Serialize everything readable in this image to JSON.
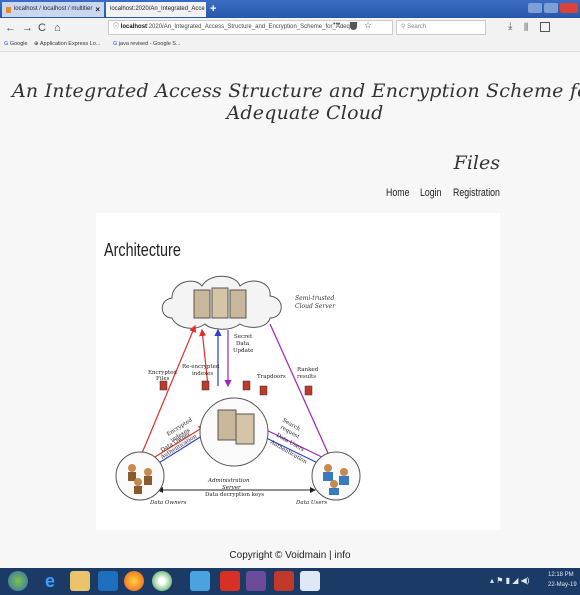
{
  "browser": {
    "tabs": [
      {
        "label": "localhost / localhost / multitier"
      },
      {
        "label": "localhost:2020/An_Integrated_Acce"
      }
    ],
    "new_tab": "+",
    "nav": {
      "back": "←",
      "forward": "→",
      "reload": "C",
      "home": "⌂"
    },
    "url_host": "localhost",
    "url_rest": ":2020/An_Integrated_Access_Structure_and_Encryption_Scheme_for_Adeq",
    "url_info": "ⓘ",
    "url_extra": "•••",
    "search_placeholder": "Search",
    "bookmarks": [
      {
        "label": "Google"
      },
      {
        "label": "Application Express Lo..."
      },
      {
        "label": "java revised - Google S..."
      }
    ]
  },
  "page": {
    "title_line1": "An Integrated Access Structure and Encryption Scheme for Adequate Cloud",
    "title_line2": "Files",
    "menu": {
      "home": "Home",
      "login": "Login",
      "registration": "Registration"
    },
    "section_title": "Architecture",
    "footer": "Copyright © Voidmain | info"
  },
  "diagram": {
    "cloud_label_1": "Semi-trusted",
    "cloud_label_2": "Cloud Server",
    "encrypted_files_1": "Encrypted",
    "encrypted_files_2": "Files",
    "reencrypted_1": "Re-encrypted",
    "reencrypted_2": "indexes",
    "secret_1": "Secret",
    "secret_2": "Data",
    "secret_3": "Update",
    "trapdoors": "Trapdoors",
    "ranked_1": "Ranked",
    "ranked_2": "results",
    "encrypted_indexes_1": "Encrypted",
    "encrypted_indexes_2": "indexes",
    "owner_auth_1": "Data Owner",
    "owner_auth_2": "Authentication",
    "search_request_1": "Search",
    "search_request_2": "request",
    "user_auth_1": "Data Users",
    "user_auth_2": "Authentication",
    "admin_1": "Administration",
    "admin_2": "Server",
    "decryption_keys": "Data decryption keys",
    "data_owners": "Data Owners",
    "data_users": "Data Users"
  },
  "taskbar": {
    "time": "12:18 PM",
    "date": "22-May-19"
  },
  "colors": {
    "tabbar": "#2a57a8",
    "taskbar": "#1c3a66",
    "arrow_red": "#e0302a",
    "arrow_blue": "#3040d0",
    "arrow_purple": "#a020c0"
  }
}
